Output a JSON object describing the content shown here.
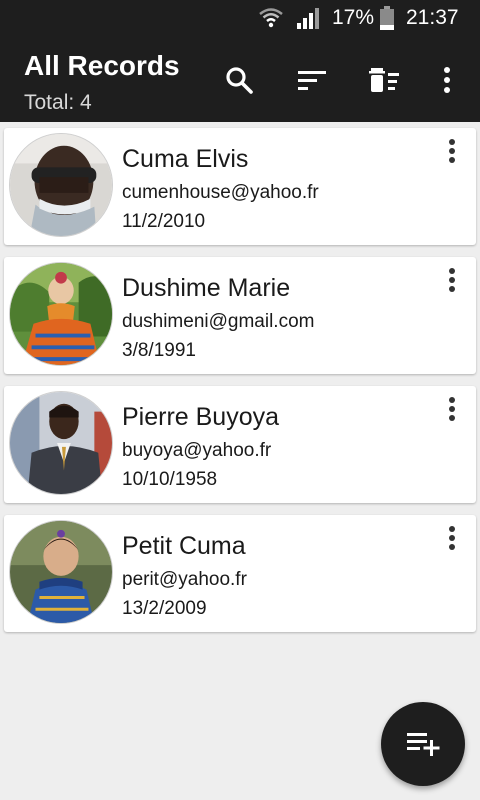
{
  "status_bar": {
    "battery_percent": "17%",
    "time": "21:37"
  },
  "app_bar": {
    "title": "All Records",
    "subtitle": "Total: 4",
    "actions": [
      "search-icon",
      "sort-icon",
      "delete-sweep-icon",
      "more-vert-icon"
    ]
  },
  "records": [
    {
      "name": "Cuma Elvis",
      "email": "cumenhouse@yahoo.fr",
      "date": "11/2/2010"
    },
    {
      "name": "Dushime Marie",
      "email": "dushimeni@gmail.com",
      "date": "3/8/1991"
    },
    {
      "name": "Pierre Buyoya",
      "email": "buyoya@yahoo.fr",
      "date": "10/10/1958"
    },
    {
      "name": "Petit Cuma",
      "email": "perit@yahoo.fr",
      "date": "13/2/2009"
    }
  ],
  "fab": {
    "icon": "playlist-add-icon"
  },
  "colors": {
    "app_bar": "#1e1e1e",
    "background": "#eeeeee",
    "card": "#ffffff"
  }
}
